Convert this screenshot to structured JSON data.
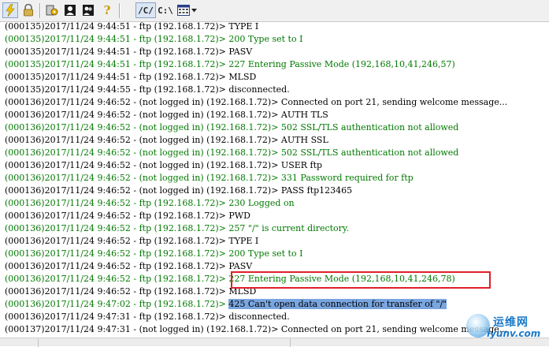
{
  "toolbar": {
    "path_button": "/C/",
    "drive_button": "C:\\"
  },
  "log_lines": [
    {
      "text": "(000135)2017/11/24 9:44:51 - ftp (192.168.1.72)> TYPE I",
      "color": "black"
    },
    {
      "text": "(000135)2017/11/24 9:44:51 - ftp (192.168.1.72)> 200 Type set to I",
      "color": "green"
    },
    {
      "text": "(000135)2017/11/24 9:44:51 - ftp (192.168.1.72)> PASV",
      "color": "black"
    },
    {
      "text": "(000135)2017/11/24 9:44:51 - ftp (192.168.1.72)> 227 Entering Passive Mode (192,168,10,41,246,57)",
      "color": "green"
    },
    {
      "text": "(000135)2017/11/24 9:44:51 - ftp (192.168.1.72)> MLSD",
      "color": "black"
    },
    {
      "text": "(000135)2017/11/24 9:44:55 - ftp (192.168.1.72)> disconnected.",
      "color": "black"
    },
    {
      "text": "(000136)2017/11/24 9:46:52 - (not logged in) (192.168.1.72)> Connected on port 21, sending welcome message...",
      "color": "black"
    },
    {
      "text": "(000136)2017/11/24 9:46:52 - (not logged in) (192.168.1.72)> AUTH TLS",
      "color": "black"
    },
    {
      "text": "(000136)2017/11/24 9:46:52 - (not logged in) (192.168.1.72)> 502 SSL/TLS authentication not allowed",
      "color": "green"
    },
    {
      "text": "(000136)2017/11/24 9:46:52 - (not logged in) (192.168.1.72)> AUTH SSL",
      "color": "black"
    },
    {
      "text": "(000136)2017/11/24 9:46:52 - (not logged in) (192.168.1.72)> 502 SSL/TLS authentication not allowed",
      "color": "green"
    },
    {
      "text": "(000136)2017/11/24 9:46:52 - (not logged in) (192.168.1.72)> USER ftp",
      "color": "black"
    },
    {
      "text": "(000136)2017/11/24 9:46:52 - (not logged in) (192.168.1.72)> 331 Password required for ftp",
      "color": "green"
    },
    {
      "text": "(000136)2017/11/24 9:46:52 - (not logged in) (192.168.1.72)> PASS ftp123465",
      "color": "black"
    },
    {
      "text": "(000136)2017/11/24 9:46:52 - ftp (192.168.1.72)> 230 Logged on",
      "color": "green"
    },
    {
      "text": "(000136)2017/11/24 9:46:52 - ftp (192.168.1.72)> PWD",
      "color": "black"
    },
    {
      "text": "(000136)2017/11/24 9:46:52 - ftp (192.168.1.72)> 257 \"/\" is current directory.",
      "color": "green"
    },
    {
      "text": "(000136)2017/11/24 9:46:52 - ftp (192.168.1.72)> TYPE I",
      "color": "black"
    },
    {
      "text": "(000136)2017/11/24 9:46:52 - ftp (192.168.1.72)> 200 Type set to I",
      "color": "green"
    },
    {
      "text": "(000136)2017/11/24 9:46:52 - ftp (192.168.1.72)> PASV",
      "color": "black"
    },
    {
      "text": "(000136)2017/11/24 9:46:52 - ftp (192.168.1.72)> 227 Entering Passive Mode (192,168,10,41,246,78)",
      "color": "green"
    },
    {
      "text": "(000136)2017/11/24 9:46:52 - ftp (192.168.1.72)> MLSD",
      "color": "black"
    },
    {
      "prefix": "(000136)2017/11/24 9:47:02 - ftp (192.168.1.72)> ",
      "selected": "425 Can't open data connection for transfer of \"/\"",
      "color": "green"
    },
    {
      "text": "(000136)2017/11/24 9:47:31 - ftp (192.168.1.72)> disconnected.",
      "color": "black"
    },
    {
      "text": "(000137)2017/11/24 9:47:31 - (not logged in) (192.168.1.72)> Connected on port 21, sending welcome message...",
      "color": "black"
    }
  ],
  "watermark": {
    "name": "运维网",
    "site": "iyunv.com"
  },
  "colors": {
    "green_text": "#007800",
    "selection": "#7aa6e0",
    "highlight_box": "#e0202a"
  }
}
